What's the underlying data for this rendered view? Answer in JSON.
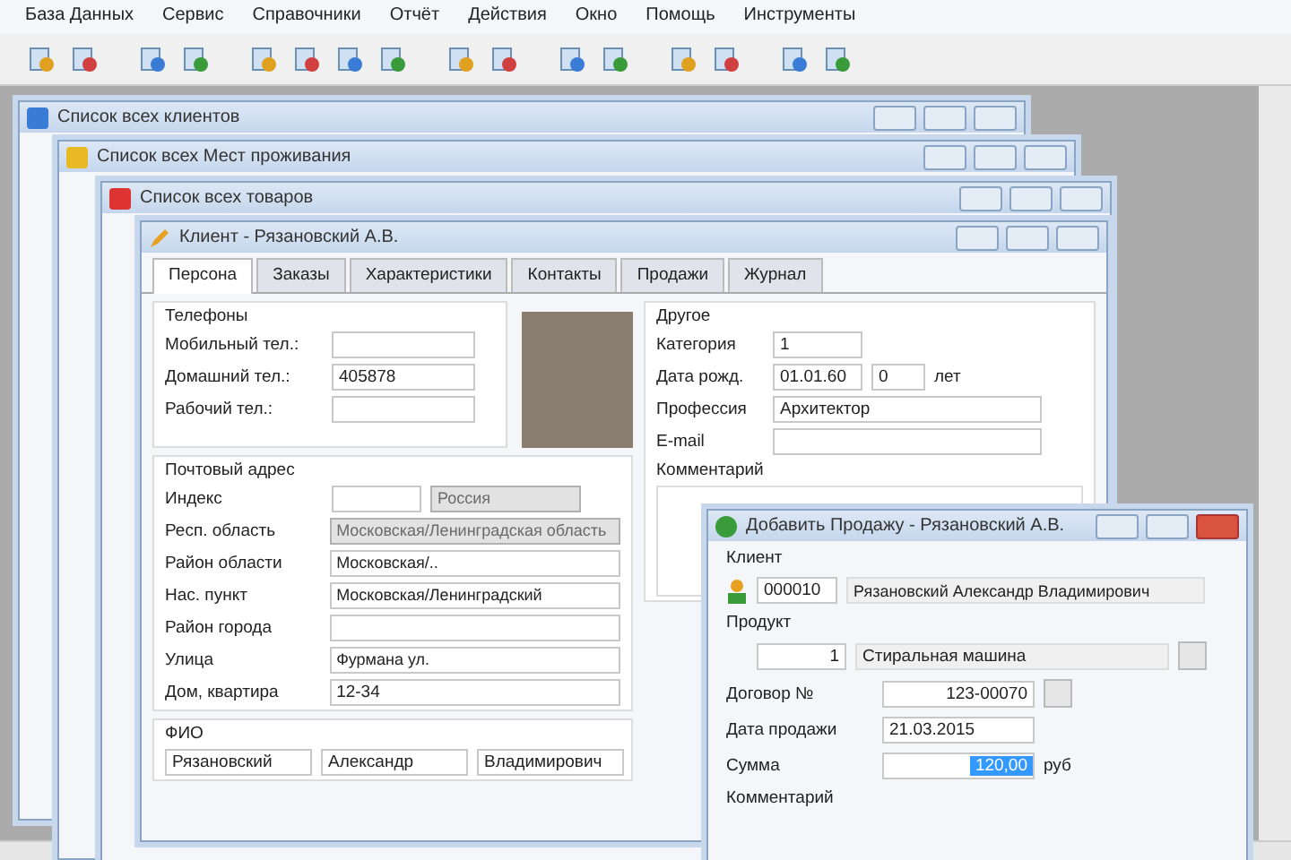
{
  "menu": [
    "База Данных",
    "Сервис",
    "Справочники",
    "Отчёт",
    "Действия",
    "Окно",
    "Помощь",
    "Инструменты"
  ],
  "back_windows": [
    {
      "title": "Список всех клиентов"
    },
    {
      "title": "Список всех Мест проживания"
    },
    {
      "title": "Список всех товаров"
    }
  ],
  "client_window": {
    "title": "Клиент - Рязановский А.В.",
    "tabs": [
      {
        "label": "Персона",
        "selected": true
      },
      {
        "label": "Заказы",
        "selected": false
      },
      {
        "label": "Характеристики",
        "selected": false
      },
      {
        "label": "Контакты",
        "selected": false
      },
      {
        "label": "Продажи",
        "selected": false
      },
      {
        "label": "Журнал",
        "selected": false
      }
    ],
    "phones": {
      "title": "Телефоны",
      "fields": [
        {
          "label": "Мобильный тел.:"
        },
        {
          "label": "Домашний тел.:",
          "value": "405878"
        },
        {
          "label": "Рабочий тел.:"
        }
      ]
    },
    "address": {
      "title": "Почтовый адрес",
      "index_label": "Индекс",
      "country": "Россия",
      "fields": [
        {
          "label": "Респ. область",
          "value": "Московская/Ленинградская область",
          "kind": "combo",
          "disabled": true
        },
        {
          "label": "Район области",
          "value": "Московская/..",
          "kind": "combo",
          "disabled": false
        },
        {
          "label": "Нас. пункт",
          "value": "Московская/Ленинградский",
          "kind": "combo",
          "disabled": false
        },
        {
          "label": "Район города",
          "kind": "combo",
          "disabled": false
        },
        {
          "label": "Улица",
          "value": "Фурмана ул.",
          "kind": "combo",
          "disabled": false
        },
        {
          "label": "Дом, квартира",
          "value": "12-34",
          "kind": "text"
        }
      ]
    },
    "fio": {
      "title": "ФИО",
      "values": [
        "Рязановский",
        "Александр",
        "Владимирович"
      ]
    },
    "other": {
      "title": "Другое",
      "category_label": "Категория",
      "category": "1",
      "birth_label": "Дата рожд.",
      "birth": "01.01.60",
      "age": "0",
      "age_unit": "лет",
      "profession_label": "Профессия",
      "profession": "Архитектор",
      "email_label": "E-mail",
      "comment_label": "Комментарий"
    }
  },
  "dialog": {
    "title": "Добавить Продажу - Рязановский А.В.",
    "client_label": "Клиент",
    "client_code": "000010",
    "client_name": "Рязановский Александр Владимирович",
    "product_label": "Продукт",
    "product_qty": "1",
    "product_name": "Стиральная машина",
    "contract_label": "Договор №",
    "contract": "123-00070",
    "date_label": "Дата продажи",
    "date": "21.03.2015",
    "sum_label": "Сумма",
    "sum": "120,00",
    "currency": "руб",
    "comment_label": "Комментарий"
  }
}
